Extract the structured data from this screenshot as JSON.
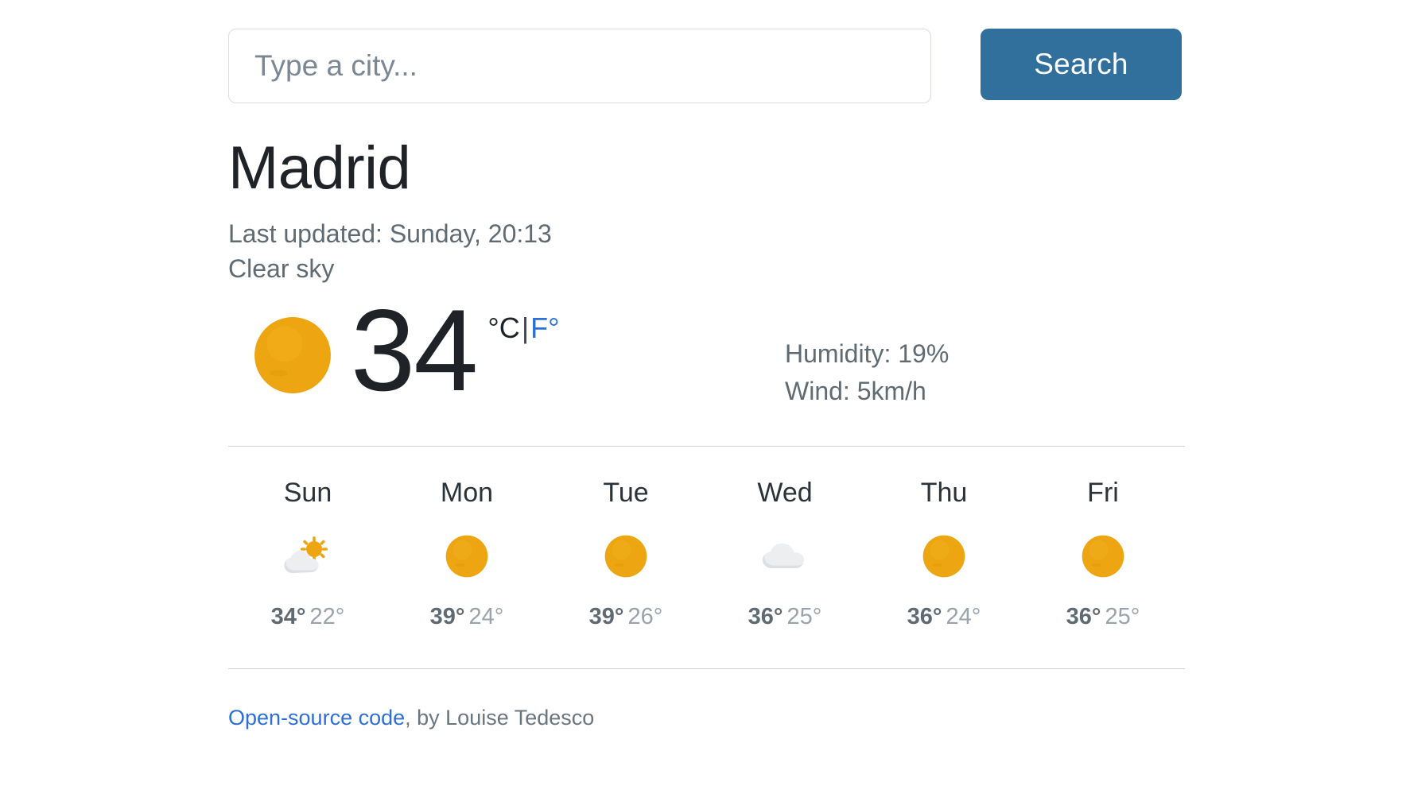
{
  "search": {
    "placeholder": "Type a city...",
    "value": "",
    "button_label": "Search"
  },
  "current": {
    "city": "Madrid",
    "last_updated": "Last updated: Sunday, 20:13",
    "condition": "Clear sky",
    "temperature": "34",
    "unit_celsius": "°C",
    "unit_separator": "|",
    "unit_fahrenheit": "F°",
    "icon": "sun-icon",
    "humidity": "Humidity: 19%",
    "wind": "Wind: 5km/h"
  },
  "forecast": [
    {
      "day": "Sun",
      "icon": "sun-behind-cloud-icon",
      "max": "34°",
      "min": "22°"
    },
    {
      "day": "Mon",
      "icon": "sun-icon",
      "max": "39°",
      "min": "24°"
    },
    {
      "day": "Tue",
      "icon": "sun-icon",
      "max": "39°",
      "min": "26°"
    },
    {
      "day": "Wed",
      "icon": "cloud-icon",
      "max": "36°",
      "min": "25°"
    },
    {
      "day": "Thu",
      "icon": "sun-icon",
      "max": "36°",
      "min": "24°"
    },
    {
      "day": "Fri",
      "icon": "sun-icon",
      "max": "36°",
      "min": "25°"
    }
  ],
  "footer": {
    "link_text": "Open-source code",
    "rest_text": ", by Louise Tedesco"
  },
  "colors": {
    "accent_button": "#31709c",
    "link": "#2d6fd4",
    "sun": "#eda512",
    "cloud": "#e9eaec",
    "divider": "#cfd2d5",
    "muted_text": "#5f6a72"
  }
}
